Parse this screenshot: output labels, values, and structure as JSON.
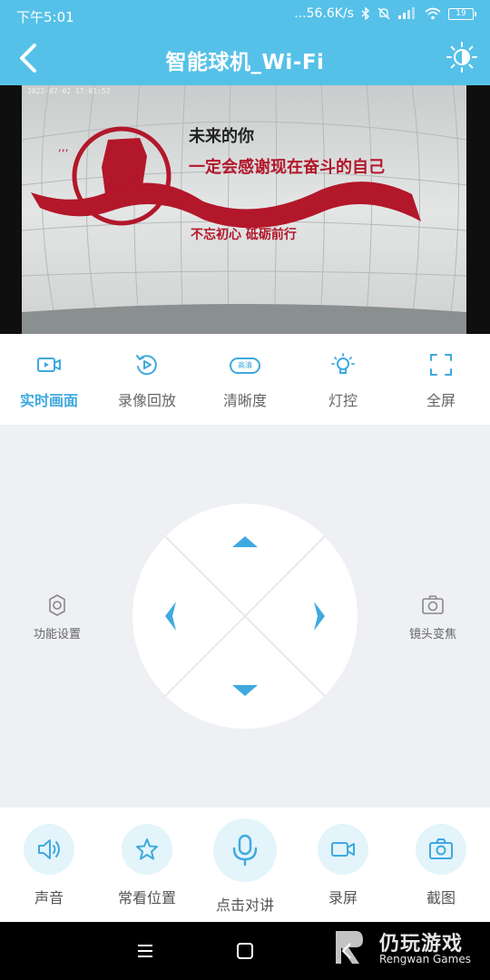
{
  "status_bar": {
    "time": "下午5:01",
    "network_speed": "...56.6K/s",
    "battery": "19"
  },
  "header": {
    "title": "智能球机_Wi-Fi"
  },
  "video": {
    "timestamp": "2022-07-02 17:01:52",
    "banner_line1": "未来的你",
    "banner_line2": "一定会感谢现在奋斗的自己",
    "banner_line3": "不忘初心  砥砺前行"
  },
  "modes": [
    {
      "label": "实时画面",
      "icon": "camera-icon",
      "active": true
    },
    {
      "label": "录像回放",
      "icon": "replay-icon"
    },
    {
      "label": "清晰度",
      "icon": "hd-badge-icon",
      "badge": "高清"
    },
    {
      "label": "灯控",
      "icon": "bulb-icon"
    },
    {
      "label": "全屏",
      "icon": "fullscreen-icon"
    }
  ],
  "control": {
    "settings_label": "功能设置",
    "zoom_label": "镜头变焦"
  },
  "bottom": {
    "sound": "声音",
    "favorite": "常看位置",
    "talk": "点击对讲",
    "record": "录屏",
    "screenshot": "截图"
  },
  "watermark": {
    "cn": "仍玩游戏",
    "en": "Rengwan Games"
  },
  "colors": {
    "accent": "#56c1e8",
    "active": "#3ea9df",
    "arrow": "#3ea9df"
  }
}
